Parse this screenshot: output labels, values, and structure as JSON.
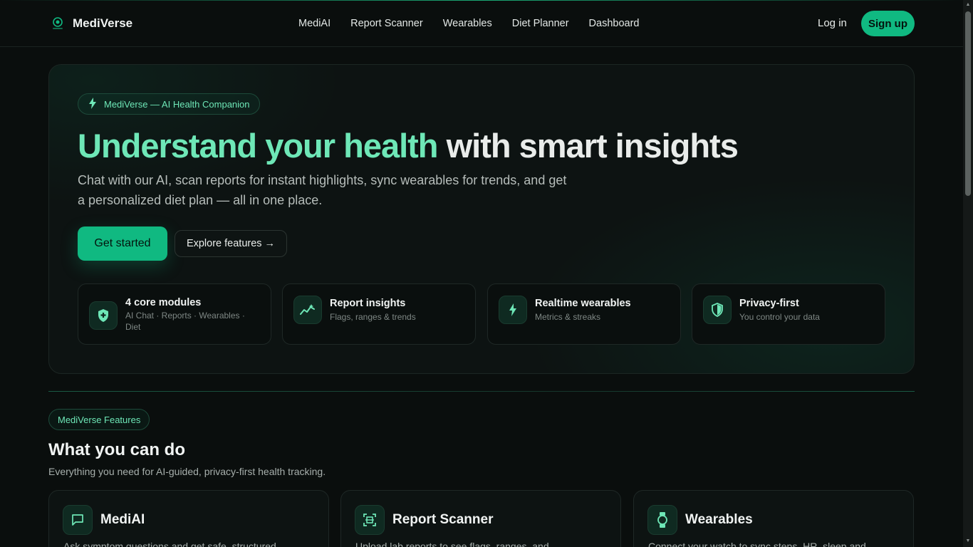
{
  "brand": {
    "name": "MediVerse",
    "accent": "#10b981"
  },
  "nav": {
    "items": [
      {
        "label": "MediAI"
      },
      {
        "label": "Report Scanner"
      },
      {
        "label": "Wearables"
      },
      {
        "label": "Diet Planner"
      },
      {
        "label": "Dashboard"
      }
    ],
    "login": "Log in",
    "signup": "Sign up"
  },
  "hero": {
    "badge": "MediVerse — AI Health Companion",
    "title_highlight": "Understand your health",
    "title_rest": " with smart insights",
    "subtitle": "Chat with our AI, scan reports for instant highlights, sync wearables for trends, and get a personalized diet plan — all in one place.",
    "primary_button": "Get started",
    "secondary_button": "Explore features →",
    "stats": [
      {
        "title": "4 core modules",
        "desc": "AI Chat · Reports · Wearables · Diet",
        "icon": "shield-plus-icon"
      },
      {
        "title": "Report insights",
        "desc": "Flags, ranges & trends",
        "icon": "sparkline-icon"
      },
      {
        "title": "Realtime wearables",
        "desc": "Metrics & streaks",
        "icon": "bolt-icon"
      },
      {
        "title": "Privacy-first",
        "desc": "You control your data",
        "icon": "shield-icon"
      }
    ]
  },
  "features": {
    "badge": "MediVerse Features",
    "title": "What you can do",
    "subtitle": "Everything you need for AI-guided, privacy-first health tracking.",
    "cards": [
      {
        "title": "MediAI",
        "desc": "Ask symptom questions and get safe, structured",
        "icon": "chat-icon"
      },
      {
        "title": "Report Scanner",
        "desc": "Upload lab reports to see flags, ranges, and",
        "icon": "scan-icon"
      },
      {
        "title": "Wearables",
        "desc": "Connect your watch to sync steps, HR, sleep and",
        "icon": "watch-icon"
      }
    ]
  }
}
